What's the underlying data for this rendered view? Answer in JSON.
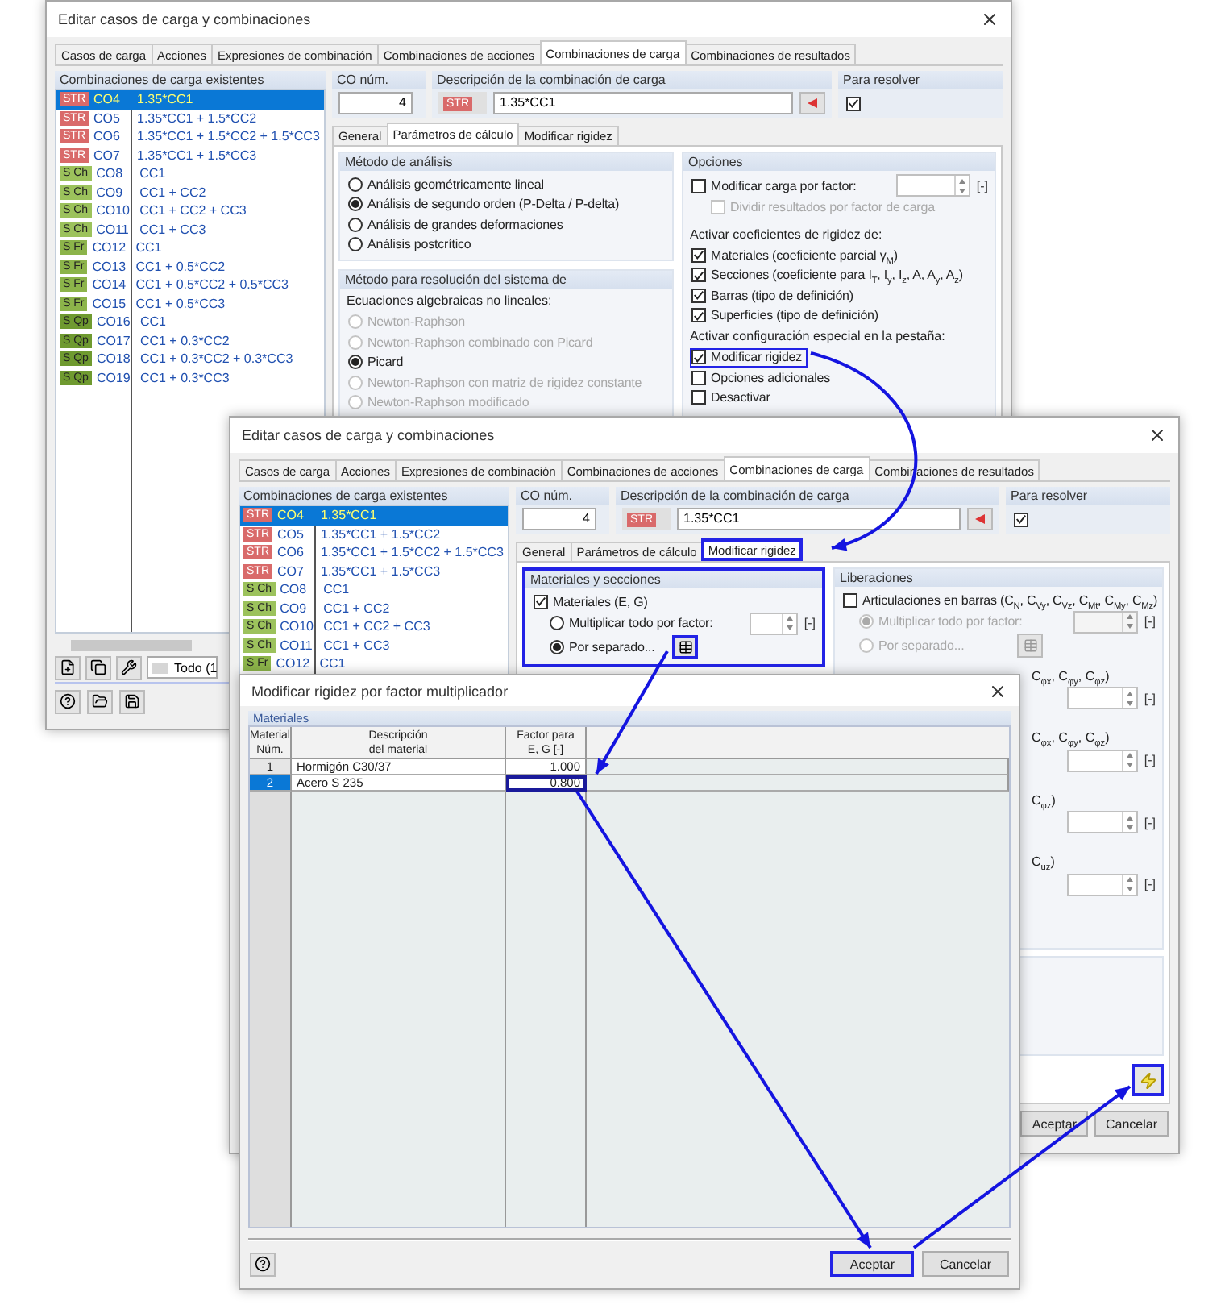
{
  "back_dialog": {
    "title": "Editar casos de carga y combinaciones",
    "tabs": [
      {
        "label": "Casos de carga",
        "selected": false
      },
      {
        "label": "Acciones",
        "selected": false
      },
      {
        "label": "Expresiones de combinación",
        "selected": false
      },
      {
        "label": "Combinaciones de acciones",
        "selected": false
      },
      {
        "label": "Combinaciones de carga",
        "selected": true
      },
      {
        "label": "Combinaciones de resultados",
        "selected": false
      }
    ],
    "list": {
      "heading": "Combinaciones de carga existentes",
      "items": [
        {
          "tag": "STR",
          "color": "#d96a6a",
          "name": "CO4",
          "formula": "1.35*CC1",
          "selected": true
        },
        {
          "tag": "STR",
          "color": "#d96a6a",
          "name": "CO5",
          "formula": "1.35*CC1 + 1.5*CC2",
          "selected": false
        },
        {
          "tag": "STR",
          "color": "#d96a6a",
          "name": "CO6",
          "formula": "1.35*CC1 + 1.5*CC2 + 1.5*CC3",
          "selected": false
        },
        {
          "tag": "STR",
          "color": "#d96a6a",
          "name": "CO7",
          "formula": "1.35*CC1 + 1.5*CC3",
          "selected": false
        },
        {
          "tag": "S Ch",
          "color": "#9cc25c",
          "name": "CO8",
          "formula": "CC1",
          "selected": false
        },
        {
          "tag": "S Ch",
          "color": "#9cc25c",
          "name": "CO9",
          "formula": "CC1 + CC2",
          "selected": false
        },
        {
          "tag": "S Ch",
          "color": "#9cc25c",
          "name": "CO10",
          "formula": "CC1 + CC2 + CC3",
          "selected": false
        },
        {
          "tag": "S Ch",
          "color": "#9cc25c",
          "name": "CO11",
          "formula": "CC1 + CC3",
          "selected": false
        },
        {
          "tag": "S Fr",
          "color": "#8cb44a",
          "name": "CO12",
          "formula": "CC1",
          "selected": false
        },
        {
          "tag": "S Fr",
          "color": "#8cb44a",
          "name": "CO13",
          "formula": "CC1 + 0.5*CC2",
          "selected": false
        },
        {
          "tag": "S Fr",
          "color": "#8cb44a",
          "name": "CO14",
          "formula": "CC1 + 0.5*CC2 + 0.5*CC3",
          "selected": false
        },
        {
          "tag": "S Fr",
          "color": "#8cb44a",
          "name": "CO15",
          "formula": "CC1 + 0.5*CC3",
          "selected": false
        },
        {
          "tag": "S Qp",
          "color": "#6f9a30",
          "name": "CO16",
          "formula": "CC1",
          "selected": false
        },
        {
          "tag": "S Qp",
          "color": "#6f9a30",
          "name": "CO17",
          "formula": "CC1 + 0.3*CC2",
          "selected": false
        },
        {
          "tag": "S Qp",
          "color": "#6f9a30",
          "name": "CO18",
          "formula": "CC1 + 0.3*CC2 + 0.3*CC3",
          "selected": false
        },
        {
          "tag": "S Qp",
          "color": "#6f9a30",
          "name": "CO19",
          "formula": "CC1 + 0.3*CC3",
          "selected": false
        }
      ]
    },
    "number": {
      "label": "CO núm.",
      "value": "4"
    },
    "description": {
      "label": "Descripción de la combinación de carga",
      "tag": "STR",
      "color": "#d96a6a",
      "value": "1.35*CC1"
    },
    "solve": {
      "label": "Para resolver",
      "checked": true
    },
    "subtabs": [
      {
        "label": "General",
        "selected": false
      },
      {
        "label": "Parámetros de cálculo",
        "selected": true
      },
      {
        "label": "Modificar rigidez",
        "selected": false
      }
    ],
    "analysis": {
      "heading": "Método de análisis",
      "options": [
        {
          "label": "Análisis geométricamente lineal",
          "selected": false
        },
        {
          "label": "Análisis de segundo orden (P-Delta / P-delta)",
          "selected": true
        },
        {
          "label": "Análisis de grandes deformaciones",
          "selected": false
        },
        {
          "label": "Análisis postcrítico",
          "selected": false
        }
      ]
    },
    "solver": {
      "heading": "Método para resolución del sistema de",
      "subheading": "Ecuaciones algebraicas no lineales:",
      "options": [
        {
          "label": "Newton-Raphson",
          "selected": false,
          "disabled": true
        },
        {
          "label": "Newton-Raphson combinado con Picard",
          "selected": false,
          "disabled": true
        },
        {
          "label": "Picard",
          "selected": true,
          "disabled": false
        },
        {
          "label": "Newton-Raphson con matriz de rigidez constante",
          "selected": false,
          "disabled": true
        },
        {
          "label": "Newton-Raphson modificado",
          "selected": false,
          "disabled": true
        }
      ]
    },
    "options": {
      "heading": "Opciones",
      "modify_load": {
        "label": "Modificar carga por factor:",
        "checked": false
      },
      "unit": "[-]",
      "divide": {
        "label": "Dividir resultados por factor de carga",
        "checked": false,
        "disabled": true
      },
      "stiffness_heading": "Activar coeficientes de rigidez de:",
      "stiffness": [
        {
          "label": "Materiales (coeficiente parcial γ$_{M}$)",
          "checked": true
        },
        {
          "label": "Secciones (coeficiente para I$_{T}$, I$_{y}$, I$_{z}$, A, A$_{y}$, A$_{z}$)",
          "checked": true
        },
        {
          "label": "Barras (tipo de definición)",
          "checked": true
        },
        {
          "label": "Superficies (tipo de definición)",
          "checked": true
        }
      ],
      "special_heading": "Activar configuración especial en la pestaña:",
      "special": [
        {
          "label": "Modificar rigidez",
          "checked": true,
          "highlighted": true
        },
        {
          "label": "Opciones adicionales",
          "checked": false,
          "highlighted": false
        },
        {
          "label": "Desactivar",
          "checked": false,
          "highlighted": false
        }
      ]
    },
    "filter": {
      "value": "Todo (1"
    }
  },
  "front_dialog": {
    "title": "Editar casos de carga y combinaciones",
    "tabs": [
      {
        "label": "Casos de carga",
        "selected": false
      },
      {
        "label": "Acciones",
        "selected": false
      },
      {
        "label": "Expresiones de combinación",
        "selected": false
      },
      {
        "label": "Combinaciones de acciones",
        "selected": false
      },
      {
        "label": "Combinaciones de carga",
        "selected": true
      },
      {
        "label": "Combinaciones de resultados",
        "selected": false
      }
    ],
    "list": {
      "heading": "Combinaciones de carga existentes",
      "items": [
        {
          "tag": "STR",
          "color": "#d96a6a",
          "name": "CO4",
          "formula": "1.35*CC1",
          "selected": true
        },
        {
          "tag": "STR",
          "color": "#d96a6a",
          "name": "CO5",
          "formula": "1.35*CC1 + 1.5*CC2",
          "selected": false
        },
        {
          "tag": "STR",
          "color": "#d96a6a",
          "name": "CO6",
          "formula": "1.35*CC1 + 1.5*CC2 + 1.5*CC3",
          "selected": false
        },
        {
          "tag": "STR",
          "color": "#d96a6a",
          "name": "CO7",
          "formula": "1.35*CC1 + 1.5*CC3",
          "selected": false
        },
        {
          "tag": "S Ch",
          "color": "#9cc25c",
          "name": "CO8",
          "formula": "CC1",
          "selected": false
        },
        {
          "tag": "S Ch",
          "color": "#9cc25c",
          "name": "CO9",
          "formula": "CC1 + CC2",
          "selected": false
        },
        {
          "tag": "S Ch",
          "color": "#9cc25c",
          "name": "CO10",
          "formula": "CC1 + CC2 + CC3",
          "selected": false
        },
        {
          "tag": "S Ch",
          "color": "#9cc25c",
          "name": "CO11",
          "formula": "CC1 + CC3",
          "selected": false
        },
        {
          "tag": "S Fr",
          "color": "#8cb44a",
          "name": "CO12",
          "formula": "CC1",
          "selected": false
        }
      ]
    },
    "number": {
      "label": "CO núm.",
      "value": "4"
    },
    "description": {
      "label": "Descripción de la combinación de carga",
      "tag": "STR",
      "color": "#d96a6a",
      "value": "1.35*CC1"
    },
    "solve": {
      "label": "Para resolver",
      "checked": true
    },
    "subtabs": [
      {
        "label": "General",
        "selected": false,
        "highlighted": false
      },
      {
        "label": "Parámetros de cálculo",
        "selected": false,
        "highlighted": false
      },
      {
        "label": "Modificar rigidez",
        "selected": true,
        "highlighted": true
      }
    ],
    "materials": {
      "heading": "Materiales y secciones",
      "highlighted": true,
      "check": {
        "label": "Materiales (E, G)",
        "checked": true
      },
      "multiply": {
        "label": "Multiplicar todo por factor:",
        "selected": false
      },
      "unit": "[-]",
      "separate": {
        "label": "Por separado...",
        "selected": true
      },
      "separate_button": {
        "highlighted": true
      }
    },
    "releases": {
      "heading": "Liberaciones",
      "check": {
        "label": "Articulaciones en barras (C$_{N}$, C$_{Vy}$, C$_{Vz}$, C$_{Mt}$, C$_{My}$, C$_{Mz}$)",
        "checked": false
      },
      "multiply": {
        "label": "Multiplicar todo por factor:",
        "selected": true,
        "disabled": true
      },
      "unit": "[-]",
      "separate": {
        "label": "Por separado...",
        "selected": false,
        "disabled": true
      }
    },
    "cut_rows": [
      {
        "label": "C$_{φx}$, C$_{φy}$, C$_{φz}$)",
        "unit": "[-]"
      },
      {
        "label": "C$_{φx}$, C$_{φy}$, C$_{φz}$)",
        "unit": "[-]"
      },
      {
        "label": "C$_{φz}$)",
        "unit": "[-]"
      },
      {
        "label": "C$_{uz}$)",
        "unit": "[-]"
      }
    ],
    "tool_button": {
      "highlighted": true
    },
    "buttons": [
      {
        "label": "Aceptar",
        "highlighted": false
      },
      {
        "label": "Cancelar",
        "highlighted": false
      }
    ]
  },
  "factor_dialog": {
    "title": "Modificar rigidez por factor multiplicador",
    "section": "Materiales",
    "columns": [
      {
        "lines": [
          "Material",
          "Núm."
        ]
      },
      {
        "lines": [
          "Descripción",
          "del material"
        ]
      },
      {
        "lines": [
          "Factor para",
          "E, G [-]"
        ]
      }
    ],
    "rows": [
      {
        "number": "1",
        "description": "Hormigón C30/37",
        "factor": "1.000",
        "selected": false,
        "highlighted": false
      },
      {
        "number": "2",
        "description": "Acero S 235",
        "factor": "0.800",
        "selected": true,
        "highlighted": true
      }
    ],
    "buttons": [
      {
        "label": "Aceptar",
        "highlighted": true
      },
      {
        "label": "Cancelar",
        "highlighted": false
      }
    ]
  }
}
